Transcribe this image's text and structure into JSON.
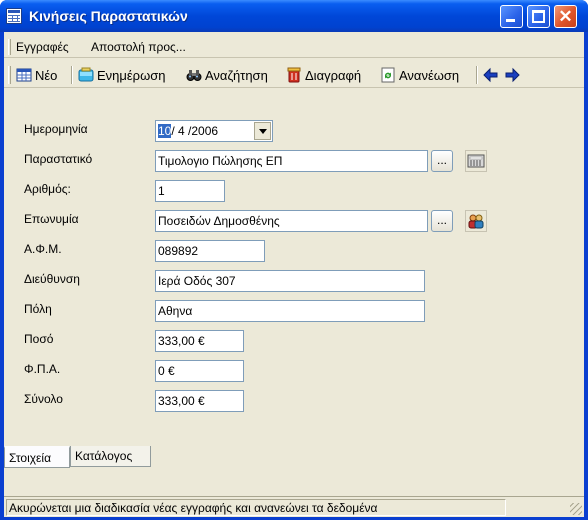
{
  "window": {
    "title": "Κινήσεις Παραστατικών"
  },
  "menu": {
    "items": [
      "Εγγραφές",
      "Αποστολή προς..."
    ]
  },
  "toolbar": {
    "new": "Νέο",
    "update": "Ενημέρωση",
    "search": "Αναζήτηση",
    "delete": "Διαγραφή",
    "refresh": "Ανανέωση"
  },
  "form": {
    "date": {
      "label": "Ημερομηνία",
      "value_selected": "10",
      "value_rest": "/ 4 /2006"
    },
    "document": {
      "label": "Παραστατικό",
      "value": "Τιμολογιο Πώλησης ΕΠ",
      "button": "..."
    },
    "number": {
      "label": "Αριθμός:",
      "value": "1"
    },
    "name": {
      "label": "Επωνυμία",
      "value": "Ποσειδών Δημοσθένης",
      "button": "..."
    },
    "vat_id": {
      "label": "Α.Φ.Μ.",
      "value": "089892"
    },
    "address": {
      "label": "Διεύθυνση",
      "value": "Ιερά Οδός 307"
    },
    "city": {
      "label": "Πόλη",
      "value": "Αθηνα"
    },
    "amount": {
      "label": "Ποσό",
      "value": "333,00 €"
    },
    "vat": {
      "label": "Φ.Π.Α.",
      "value": "0 €"
    },
    "total": {
      "label": "Σύνολο",
      "value": "333,00 €"
    }
  },
  "tabs": [
    "Στοιχεία",
    "Κατάλογος"
  ],
  "status": {
    "message": "Ακυρώνεται μια διαδικασία νέας εγγραφής και ανανεώνει τα δεδομένα"
  },
  "colors": {
    "titlebar": "#0047d8",
    "face": "#ece9d8",
    "field_border": "#7f9db9",
    "selection": "#316ac5"
  }
}
